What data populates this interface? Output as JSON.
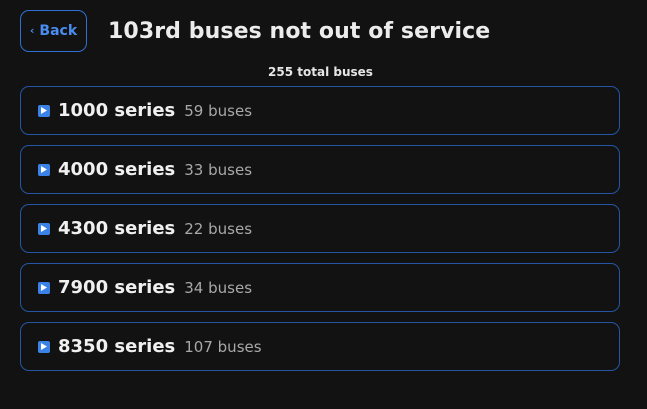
{
  "header": {
    "back_label": "Back",
    "back_icon": "chevron-left-icon",
    "title": "103rd buses not out of service"
  },
  "summary": {
    "total_text": "255 total buses"
  },
  "series": [
    {
      "name": "1000 series",
      "count": "59 buses",
      "icon": "play-icon"
    },
    {
      "name": "4000 series",
      "count": "33 buses",
      "icon": "play-icon"
    },
    {
      "name": "4300 series",
      "count": "22 buses",
      "icon": "play-icon"
    },
    {
      "name": "7900 series",
      "count": "34 buses",
      "icon": "play-icon"
    },
    {
      "name": "8350 series",
      "count": "107 buses",
      "icon": "play-icon"
    }
  ],
  "colors": {
    "background": "#121212",
    "accent": "#3b82e6",
    "border": "#2456a3",
    "muted_text": "#a8a8a8"
  }
}
